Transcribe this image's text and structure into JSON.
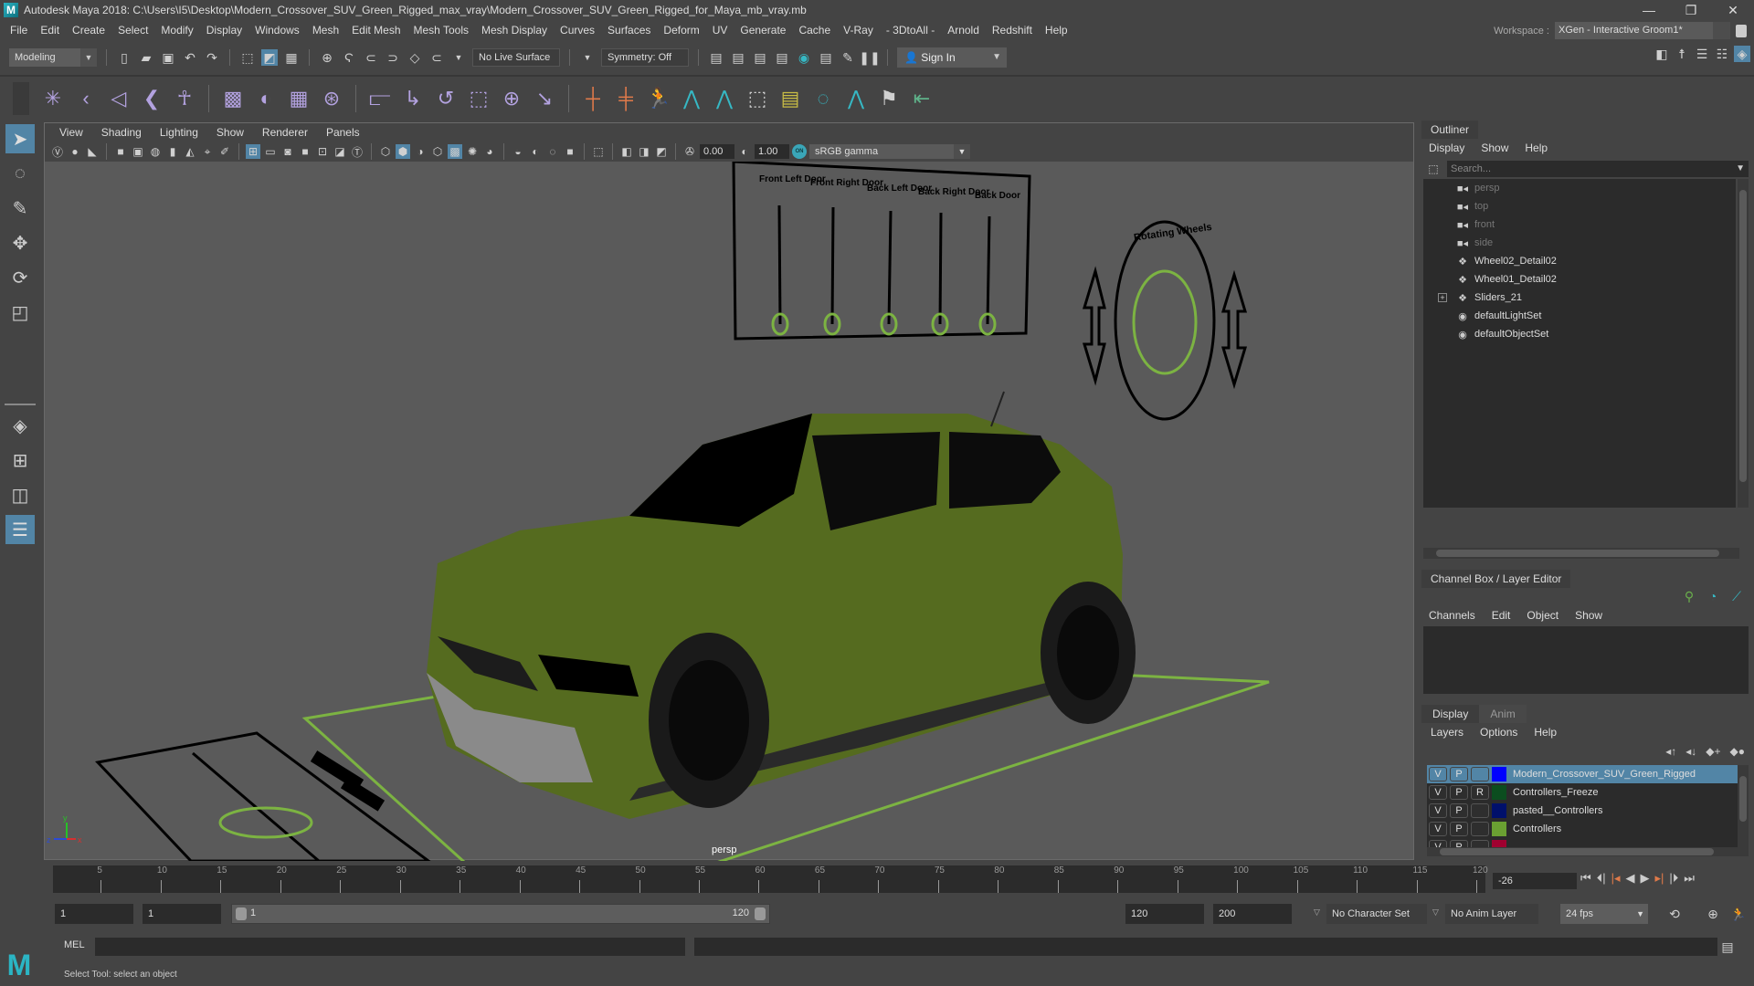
{
  "window": {
    "title": "Autodesk Maya 2018: C:\\Users\\I5\\Desktop\\Modern_Crossover_SUV_Green_Rigged_max_vray\\Modern_Crossover_SUV_Green_Rigged_for_Maya_mb_vray.mb",
    "controls": {
      "minimize": "—",
      "restore": "❐",
      "close": "✕"
    }
  },
  "menubar": [
    "File",
    "Edit",
    "Create",
    "Select",
    "Modify",
    "Display",
    "Windows",
    "Mesh",
    "Edit Mesh",
    "Mesh Tools",
    "Mesh Display",
    "Curves",
    "Surfaces",
    "Deform",
    "UV",
    "Generate",
    "Cache",
    "V-Ray",
    "- 3DtoAll -",
    "Arnold",
    "Redshift",
    "Help"
  ],
  "workspace": {
    "label": "Workspace :",
    "value": "XGen - Interactive Groom1*"
  },
  "statusline": {
    "mode": "Modeling",
    "live_surface": "No Live Surface",
    "symmetry": "Symmetry: Off",
    "sign_in": "Sign In"
  },
  "viewport": {
    "menu": [
      "View",
      "Shading",
      "Lighting",
      "Show",
      "Renderer",
      "Panels"
    ],
    "exposure": "0.00",
    "gamma": "1.00",
    "color_space": "sRGB gamma",
    "color_mgmt_badge": "ON",
    "camera": "persp",
    "axis": {
      "y": "y",
      "z": "z",
      "x": "x"
    },
    "rig_labels": [
      "Front Left Door",
      "Front Right Door",
      "Back Left Door",
      "Back Right Door",
      "Back Door"
    ],
    "wheel_label": "Rotating Wheels",
    "colors": {
      "controller_green": "#7cb342",
      "car_body": "#556b1f",
      "grid_bg": "#5a5a5a"
    }
  },
  "outliner": {
    "title": "Outliner",
    "menu": [
      "Display",
      "Show",
      "Help"
    ],
    "search_placeholder": "Search...",
    "items": [
      {
        "label": "persp",
        "icon": "camera-icon",
        "dim": true
      },
      {
        "label": "top",
        "icon": "camera-icon",
        "dim": true
      },
      {
        "label": "front",
        "icon": "camera-icon",
        "dim": true
      },
      {
        "label": "side",
        "icon": "camera-icon",
        "dim": true
      },
      {
        "label": "Wheel02_Detail02",
        "icon": "transform-icon",
        "dim": false
      },
      {
        "label": "Wheel01_Detail02",
        "icon": "transform-icon",
        "dim": false
      },
      {
        "label": "Sliders_21",
        "icon": "transform-icon",
        "dim": false,
        "expandable": true
      },
      {
        "label": "defaultLightSet",
        "icon": "set-icon",
        "dim": false
      },
      {
        "label": "defaultObjectSet",
        "icon": "set-icon",
        "dim": false
      }
    ]
  },
  "channel_box": {
    "title": "Channel Box / Layer Editor",
    "menu": [
      "Channels",
      "Edit",
      "Object",
      "Show"
    ]
  },
  "layer_editor": {
    "tabs": [
      "Display",
      "Anim"
    ],
    "menu": [
      "Layers",
      "Options",
      "Help"
    ],
    "layers": [
      {
        "v": "V",
        "p": "P",
        "r": "",
        "color": "#0000ff",
        "name": "Modern_Crossover_SUV_Green_Rigged",
        "selected": true
      },
      {
        "v": "V",
        "p": "P",
        "r": "R",
        "color": "#0b4d1f",
        "name": "Controllers_Freeze",
        "selected": false
      },
      {
        "v": "V",
        "p": "P",
        "r": "",
        "color": "#00106b",
        "name": "pasted__Controllers",
        "selected": false
      },
      {
        "v": "V",
        "p": "P",
        "r": "",
        "color": "#6aa032",
        "name": "Controllers",
        "selected": false
      },
      {
        "v": "V",
        "p": "P",
        "r": "",
        "color": "#a00030",
        "name": "",
        "selected": false
      }
    ]
  },
  "timeline": {
    "ticks": [
      5,
      10,
      15,
      20,
      25,
      30,
      35,
      40,
      45,
      50,
      55,
      60,
      65,
      70,
      75,
      80,
      85,
      90,
      95,
      100,
      105,
      110,
      115,
      120
    ],
    "range_min": 1,
    "range_max": 120,
    "current_frame": "-26"
  },
  "range": {
    "start": "1",
    "playback_start": "1",
    "slider_start": "1",
    "slider_end": "120",
    "playback_end": "120",
    "end": "200",
    "character_set": "No Character Set",
    "anim_layer": "No Anim Layer",
    "fps": "24 fps"
  },
  "cmdline": {
    "lang": "MEL"
  },
  "helpline": {
    "text": "Select Tool: select an object"
  }
}
